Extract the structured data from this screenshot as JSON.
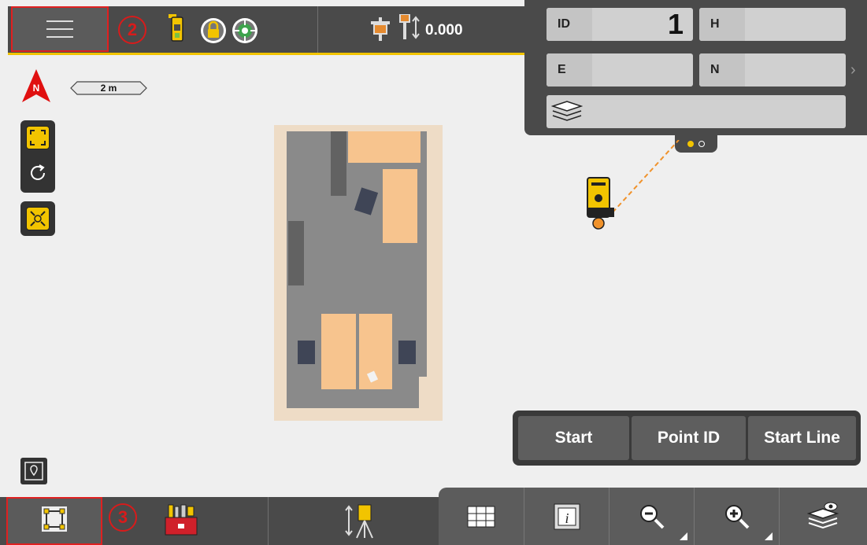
{
  "topbar": {
    "height_value": "0.000"
  },
  "markers": {
    "menu": "2",
    "plan": "3"
  },
  "panel": {
    "fields": [
      {
        "label": "ID",
        "value": "1"
      },
      {
        "label": "H",
        "value": ""
      },
      {
        "label": "E",
        "value": ""
      },
      {
        "label": "N",
        "value": ""
      }
    ],
    "page_count": 2,
    "active_page": 1
  },
  "map": {
    "north_label": "N",
    "scale_label": "2 m"
  },
  "actions": {
    "start": "Start",
    "point_id": "Point ID",
    "start_line": "Start Line"
  },
  "icons": [
    "menu-icon",
    "instrument-icon",
    "lock-icon",
    "target-icon",
    "prism-icon",
    "height-icon",
    "layers-icon",
    "north-arrow-icon",
    "zoom-extent-icon",
    "rotate-icon",
    "center-icon",
    "map-pin-icon",
    "plan-icon",
    "toolbox-icon",
    "setup-icon",
    "table-icon",
    "info-icon",
    "zoom-out-icon",
    "zoom-in-icon",
    "layer-visibility-icon"
  ],
  "colors": {
    "accent": "#f2c400",
    "highlight": "#e02020",
    "bar": "#4a4a4a"
  }
}
